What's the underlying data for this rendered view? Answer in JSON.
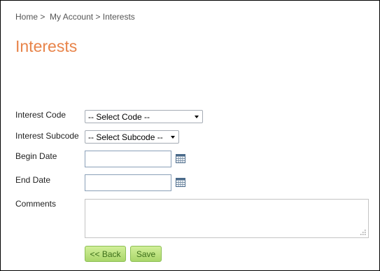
{
  "breadcrumb": {
    "home": "Home",
    "sep1": ">",
    "my_account": "My Account",
    "sep2": ">",
    "current": "Interests"
  },
  "page_title": "Interests",
  "form": {
    "interest_code": {
      "label": "Interest Code",
      "selected": "-- Select Code --"
    },
    "interest_subcode": {
      "label": "Interest Subcode",
      "selected": "-- Select Subcode --"
    },
    "begin_date": {
      "label": "Begin Date",
      "value": ""
    },
    "end_date": {
      "label": "End Date",
      "value": ""
    },
    "comments": {
      "label": "Comments",
      "value": ""
    }
  },
  "buttons": {
    "back_label": "<< Back",
    "save_label": "Save"
  },
  "icons": {
    "calendar": "calendar-icon",
    "dropdown": "chevron-down-icon",
    "resize": "resize-grip-icon"
  },
  "colors": {
    "title": "#e8844a",
    "button_text": "#3d6f1a",
    "button_bg": "#a9d66a"
  }
}
